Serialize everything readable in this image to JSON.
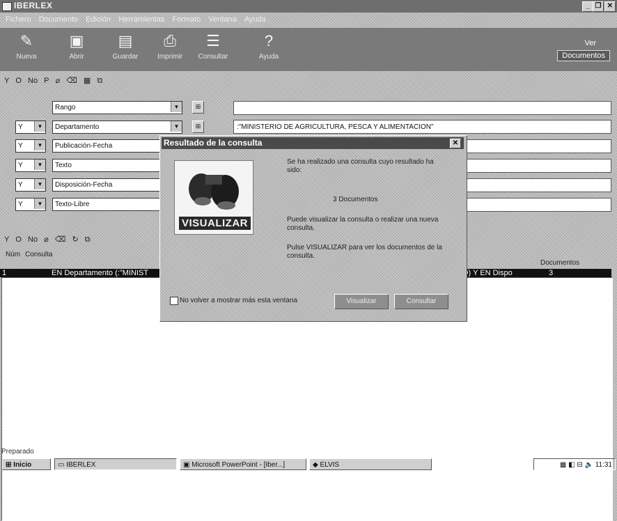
{
  "window": {
    "title": "IBERLEX"
  },
  "menu": {
    "items": [
      "Fichero",
      "Documento",
      "Edición",
      "Herramientas",
      "Formato",
      "Ventana",
      "Ayuda"
    ]
  },
  "toolbar": {
    "buttons": [
      "Nueva",
      "Abrir",
      "Guardar",
      "Imprimir",
      "Consultar",
      "Ayuda"
    ],
    "ver_documentos": {
      "line1": "Ver",
      "line2": "Documentos"
    }
  },
  "operators": [
    "Y",
    "O",
    "No",
    "P"
  ],
  "criteria": {
    "rows": [
      {
        "op": "",
        "field": "Rango",
        "value": ""
      },
      {
        "op": "Y",
        "field": "Departamento",
        "value": ":\"MINISTERIO DE AGRICULTURA, PESCA Y ALIMENTACION\""
      },
      {
        "op": "Y",
        "field": "Publicación-Fecha",
        "value": ""
      },
      {
        "op": "Y",
        "field": "Texto",
        "value": ""
      },
      {
        "op": "Y",
        "field": "Disposición-Fecha",
        "value": ""
      },
      {
        "op": "Y",
        "field": "Texto-Libre",
        "value": ""
      }
    ]
  },
  "history": {
    "headers": {
      "num": "Núm",
      "consulta": "Consulta",
      "documentos": "Documentos"
    },
    "row": {
      "num": "1",
      "consulta": "EN Departamento (:\"MINIST",
      "tail": "O) Y EN Dispo",
      "docs": "3"
    }
  },
  "dialog": {
    "title": "Resultado de la consulta",
    "text1": "Se ha realizado una consulta cuyo resultado ha sido:",
    "count": "3 Documentos",
    "text2": "Puede visualizar la consulta o realizar una nueva consulta.",
    "text3": "Pulse VISUALIZAR para ver los documentos de la consulta.",
    "image_label": "VISUALIZAR",
    "checkbox_label": "No volver a mostrar más esta ventana",
    "btn_visualizar": "Visualizar",
    "btn_consultar": "Consultar"
  },
  "status": {
    "text": "Preparado"
  },
  "taskbar": {
    "start": "Inicio",
    "tasks": [
      "IBERLEX",
      "Microsoft PowerPoint - [Iber...]",
      "ELVIS"
    ],
    "time": "11:31"
  }
}
